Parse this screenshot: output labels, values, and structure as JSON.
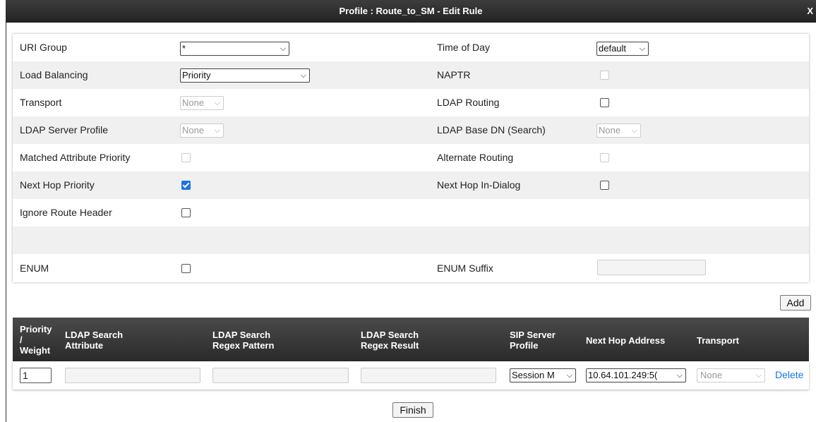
{
  "dialog": {
    "title": "Profile : Route_to_SM - Edit Rule",
    "close_label": "X"
  },
  "rules": {
    "uri_group": {
      "label": "URI Group",
      "value": "*"
    },
    "time_of_day": {
      "label": "Time of Day",
      "value": "default"
    },
    "load_balancing": {
      "label": "Load Balancing",
      "value": "Priority"
    },
    "naptr": {
      "label": "NAPTR",
      "checked": false,
      "disabled": true
    },
    "transport": {
      "label": "Transport",
      "value": "None"
    },
    "ldap_routing": {
      "label": "LDAP Routing",
      "checked": false
    },
    "ldap_server_profile": {
      "label": "LDAP Server Profile",
      "value": "None"
    },
    "ldap_base_dn": {
      "label": "LDAP Base DN (Search)",
      "value": "None"
    },
    "matched_attribute_priority": {
      "label": "Matched Attribute Priority",
      "checked": false,
      "disabled": true
    },
    "alternate_routing": {
      "label": "Alternate Routing",
      "checked": false,
      "disabled": true
    },
    "next_hop_priority": {
      "label": "Next Hop Priority",
      "checked": true
    },
    "next_hop_in_dialog": {
      "label": "Next Hop In-Dialog",
      "checked": false
    },
    "ignore_route_header": {
      "label": "Ignore Route Header",
      "checked": false
    },
    "enum": {
      "label": "ENUM",
      "checked": false
    },
    "enum_suffix": {
      "label": "ENUM Suffix",
      "value": ""
    }
  },
  "add_label": "Add",
  "table": {
    "headers": {
      "priority_weight": [
        "Priority",
        "/",
        "Weight"
      ],
      "ldap_search_attribute": [
        "LDAP Search",
        "Attribute"
      ],
      "ldap_search_regex_pattern": [
        "LDAP Search",
        "Regex Pattern"
      ],
      "ldap_search_regex_result": [
        "LDAP Search",
        "Regex Result"
      ],
      "sip_server_profile": [
        "SIP Server",
        "Profile"
      ],
      "next_hop_address": "Next Hop Address",
      "transport": "Transport"
    },
    "row": {
      "priority": "1",
      "ldap_search_attribute": "",
      "ldap_search_regex_pattern": "",
      "ldap_search_regex_result": "",
      "sip_server_profile": "Session M",
      "next_hop_address": "10.64.101.249:5(",
      "transport": "None",
      "delete_label": "Delete"
    }
  },
  "finish_label": "Finish",
  "colors": {
    "link": "#1a73e8",
    "checkbox_on": "#1a73e8",
    "titlebar": "#2a2a2a"
  }
}
